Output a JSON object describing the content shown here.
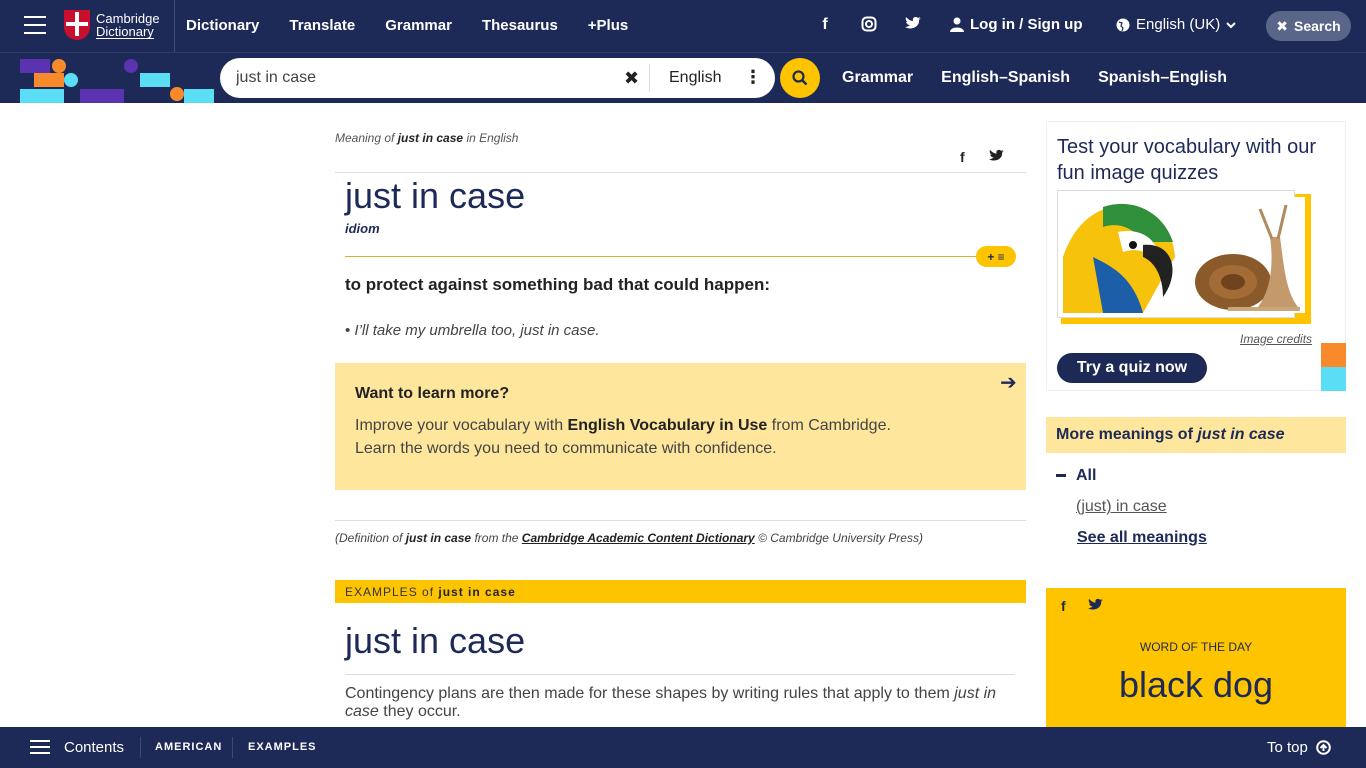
{
  "topbar": {
    "logo_line1": "Cambridge",
    "logo_line2": "Dictionary",
    "nav": [
      "Dictionary",
      "Translate",
      "Grammar",
      "Thesaurus",
      "+Plus"
    ],
    "login_label": "Log in / Sign up",
    "language_label": "English (UK)",
    "search_button_label": "Search"
  },
  "subbar": {
    "search_value": "just in case",
    "search_language": "English",
    "links": [
      "Grammar",
      "English–Spanish",
      "Spanish–English"
    ]
  },
  "entry": {
    "meaning_of_prefix": "Meaning of",
    "meaning_of_term": "just in case",
    "meaning_of_suffix": "in English",
    "headword": "just in case",
    "pos": "idiom",
    "plus_badge": "+ ≡",
    "definition": "to protect against something bad that could happen:",
    "example": "I’ll take my umbrella too, just in case."
  },
  "learn_more": {
    "title": "Want to learn more?",
    "line1_prefix": "Improve your vocabulary with",
    "line1_bold": "English Vocabulary in Use",
    "line1_suffix": "from Cambridge.",
    "line2": "Learn the words you need to communicate with confidence."
  },
  "citation": {
    "prefix": "(Definition of",
    "term": "just in case",
    "middle": "from the",
    "source": "Cambridge Academic Content Dictionary",
    "suffix": "© Cambridge University Press)"
  },
  "examples": {
    "bar_prefix": "EXAMPLES of",
    "bar_term": "just in case",
    "headword": "just in case",
    "sentence_prefix": "Contingency plans are then made for these shapes by writing rules that apply to them",
    "sentence_italic": "just in case",
    "sentence_suffix": "they occur."
  },
  "quiz": {
    "title": "Test your vocabulary with our fun image quizzes",
    "credits": "Image credits",
    "button": "Try a quiz now"
  },
  "more_meanings": {
    "prefix": "More meanings of",
    "term": "just in case",
    "all_label": "All",
    "item": "(just) in case",
    "see_all": "See all meanings"
  },
  "wotd": {
    "label": "WORD OF THE DAY",
    "word": "black dog"
  },
  "bottombar": {
    "contents": "Contents",
    "american": "AMERICAN",
    "examples": "EXAMPLES",
    "to_top": "To top"
  },
  "colors": {
    "navy": "#1d2a57",
    "yellow": "#fec400",
    "light_yellow": "#fee69c",
    "orange": "#f98a2b",
    "cyan": "#59def6",
    "purple": "#5b32b0"
  },
  "icons": {
    "menu": "hamburger-icon",
    "facebook": "facebook-icon",
    "instagram": "instagram-icon",
    "twitter": "twitter-icon",
    "user": "user-icon",
    "globe": "globe-icon",
    "close": "close-icon",
    "search": "search-icon",
    "more": "more-vertical-icon",
    "arrow": "arrow-right-icon",
    "up": "arrow-up-circle-icon"
  }
}
